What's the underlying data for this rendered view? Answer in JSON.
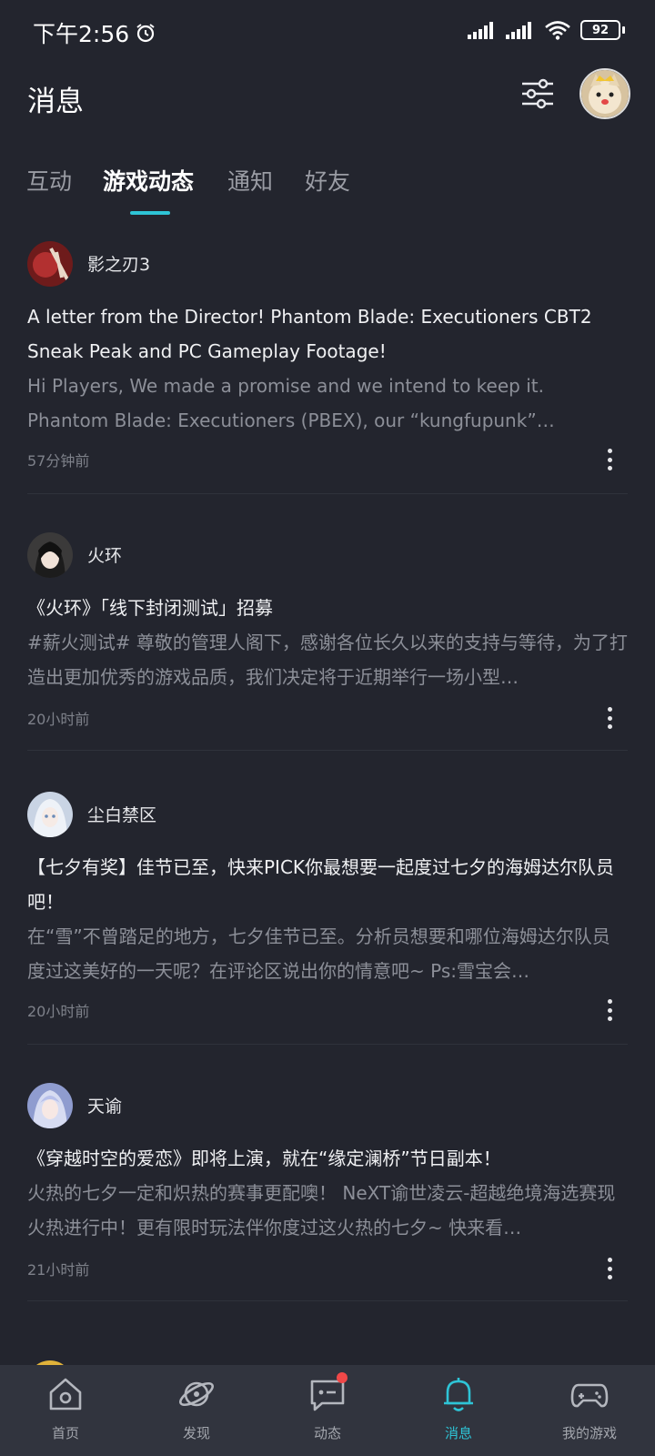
{
  "status": {
    "time": "下午2:56",
    "battery": "92"
  },
  "header": {
    "title": "消息"
  },
  "tabs": [
    {
      "label": "互动"
    },
    {
      "label": "游戏动态"
    },
    {
      "label": "通知"
    },
    {
      "label": "好友"
    }
  ],
  "feed": [
    {
      "name": "影之刃3",
      "title": "A letter from the Director! Phantom Blade: Executioners CBT2 Sneak Peak and PC Gameplay Footage!",
      "body": "Hi Players, We made a promise and we intend to keep it. Phantom Blade: Executioners (PBEX), our “kungfupunk” brainchild…",
      "time": "57分钟前"
    },
    {
      "name": "火环",
      "title": "《火环》「线下封闭测试」招募",
      "body": "#薪火测试# 尊敬的管理人阁下，感谢各位长久以来的支持与等待，为了打造出更加优秀的游戏品质，我们决定将于近期举行一场小型…",
      "time": "20小时前"
    },
    {
      "name": "尘白禁区",
      "title": "【七夕有奖】佳节已至，快来PICK你最想要一起度过七夕的海姆达尔队员吧！",
      "body": "在“雪”不曾踏足的地方，七夕佳节已至。分析员想要和哪位海姆达尔队员度过这美好的一天呢？在评论区说出你的情意吧~ Ps:雪宝会…",
      "time": "20小时前"
    },
    {
      "name": "天谕",
      "title": "《穿越时空的爱恋》即将上演，就在“缘定澜桥”节日副本！",
      "body": "火热的七夕一定和炽热的赛事更配噢！ NeXT谕世凌云-超越绝境海选赛现火热进行中！更有限时玩法伴你度过这火热的七夕~ 快来看…",
      "time": "21小时前"
    }
  ],
  "nav": [
    {
      "label": "首页",
      "icon": "home-icon"
    },
    {
      "label": "发现",
      "icon": "planet-icon"
    },
    {
      "label": "动态",
      "icon": "chat-icon"
    },
    {
      "label": "消息",
      "icon": "bell-icon"
    },
    {
      "label": "我的游戏",
      "icon": "gamepad-icon"
    }
  ],
  "colors": {
    "accent": "#2ec4d6",
    "background": "#23252e",
    "nav_bg": "#31343e",
    "badge": "#f04848"
  }
}
